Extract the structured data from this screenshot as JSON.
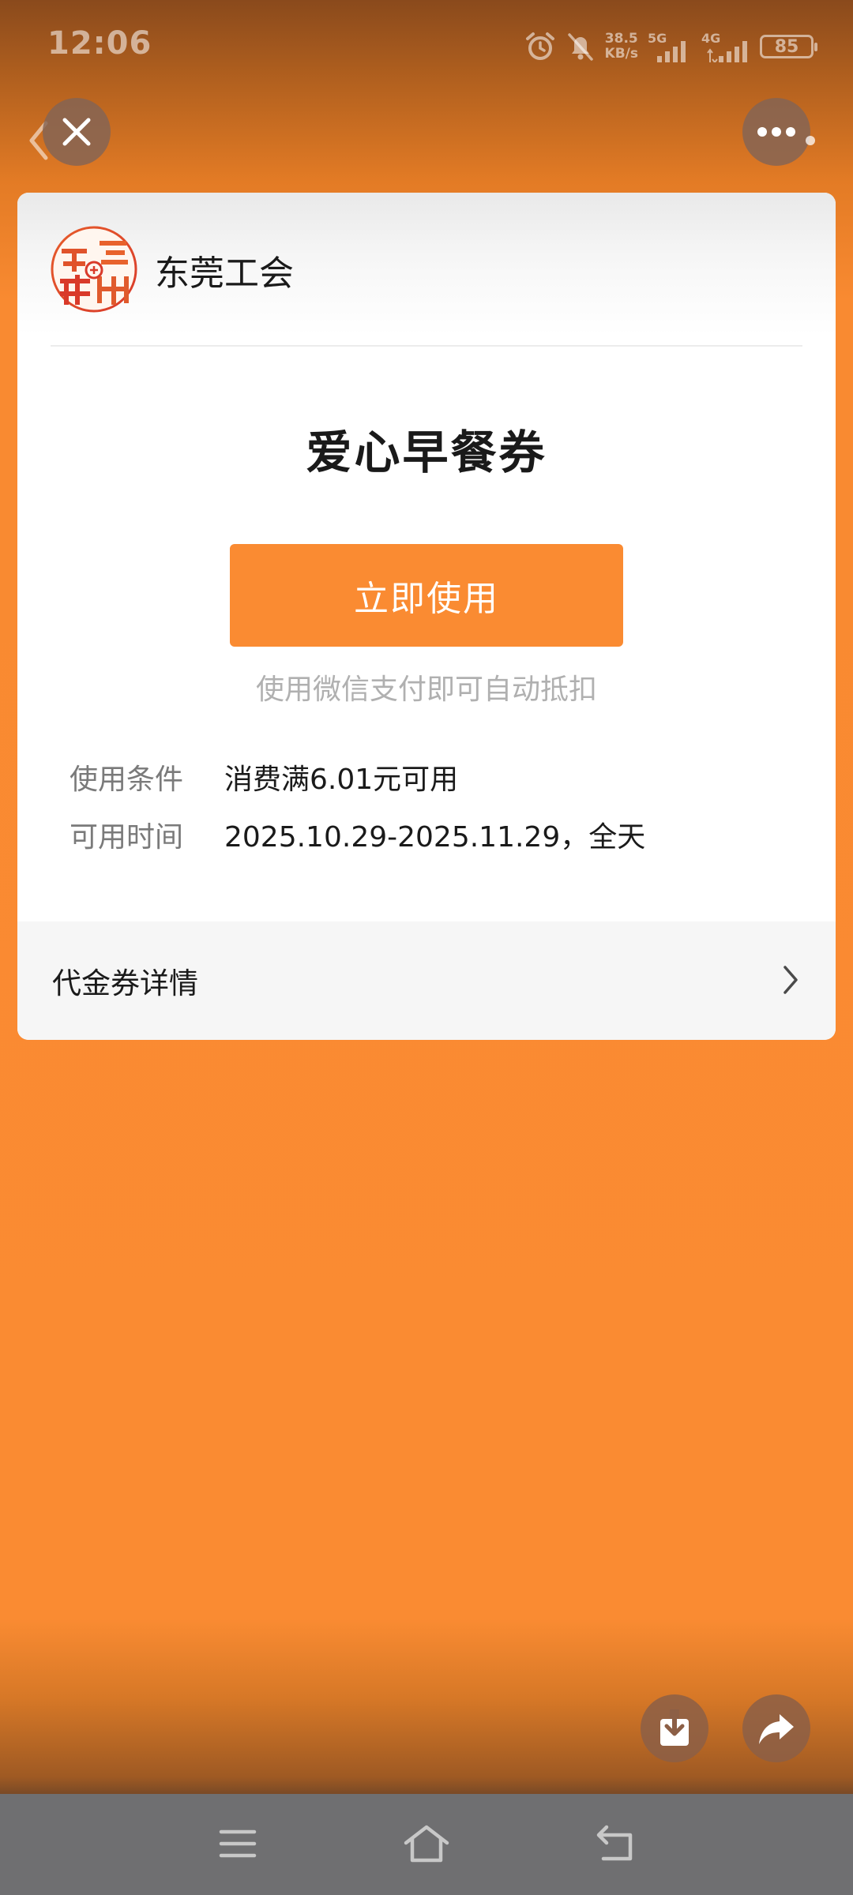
{
  "status_bar": {
    "time": "12:06",
    "net_speed_value": "38.5",
    "net_speed_unit": "KB/s",
    "sim1_label": "5G",
    "sim2_label": "4G",
    "battery": "85",
    "icons": [
      "alarm-icon",
      "mute-bell-icon",
      "signal-icon",
      "signal-icon"
    ]
  },
  "nav": {
    "close_icon": "close-icon",
    "back_icon": "chevron-left-icon",
    "more_icon": "more-dots-icon"
  },
  "card": {
    "org_name": "东莞工会",
    "coupon_title": "爱心早餐券",
    "use_button_label": "立即使用",
    "auto_hint": "使用微信支付即可自动抵扣",
    "info": [
      {
        "label": "使用条件",
        "value": "消费满6.01元可用"
      },
      {
        "label": "可用时间",
        "value": "2025.10.29-2025.11.29，全天"
      }
    ],
    "details_label": "代金券详情"
  },
  "actions": {
    "download_icon": "download-icon",
    "share_icon": "share-icon"
  },
  "system_nav": {
    "icons": [
      "menu-icon",
      "home-icon",
      "back-icon"
    ]
  },
  "colors": {
    "accent": "#fa8b32",
    "nav_bar": "#6f6f71"
  }
}
